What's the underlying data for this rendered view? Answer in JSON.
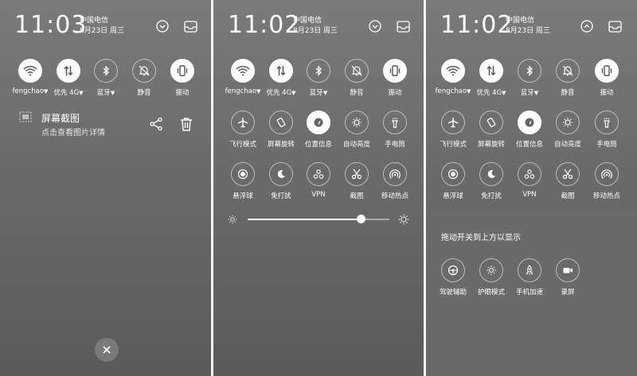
{
  "status": {
    "times": [
      "11:03",
      "11:02",
      "11:02"
    ],
    "carrier": "中国电信",
    "date": "8月23日 周三"
  },
  "toggles": [
    {
      "label": "fengchao",
      "icon": "wifi-icon",
      "dropdown": true,
      "on": true
    },
    {
      "label": "优先 4G",
      "icon": "data-arrows-icon",
      "dropdown": true,
      "on": true
    },
    {
      "label": "蓝牙",
      "icon": "bluetooth-icon",
      "dropdown": true,
      "on": false
    },
    {
      "label": "静音",
      "icon": "mute-bell-icon",
      "dropdown": false,
      "on": false
    },
    {
      "label": "振动",
      "icon": "vibrate-icon",
      "dropdown": false,
      "on": true
    }
  ],
  "toggles_row2": [
    {
      "label": "飞行模式",
      "icon": "airplane-icon",
      "on": false
    },
    {
      "label": "屏幕旋转",
      "icon": "rotate-icon",
      "on": false
    },
    {
      "label": "位置信息",
      "icon": "location-icon",
      "on": true
    },
    {
      "label": "自动亮度",
      "icon": "auto-brightness-icon",
      "on": false
    },
    {
      "label": "手电筒",
      "icon": "flashlight-icon",
      "on": false
    }
  ],
  "toggles_row3": [
    {
      "label": "悬浮球",
      "icon": "float-ball-icon",
      "on": false
    },
    {
      "label": "免打扰",
      "icon": "moon-icon",
      "on": false
    },
    {
      "label": "VPN",
      "icon": "vpn-icon",
      "on": false
    },
    {
      "label": "截图",
      "icon": "scissors-icon",
      "on": false
    },
    {
      "label": "移动热点",
      "icon": "hotspot-icon",
      "on": false
    }
  ],
  "notification": {
    "title": "屏幕截图",
    "subtitle": "点击查看图片详情"
  },
  "brightness": {
    "level": 0.8
  },
  "drag_hint": "拖动开关到上方以显示",
  "extra_toggles": [
    {
      "label": "驾驶辅助",
      "icon": "steering-wheel-icon"
    },
    {
      "label": "护眼模式",
      "icon": "eye-care-icon"
    },
    {
      "label": "手机加速",
      "icon": "rocket-icon"
    },
    {
      "label": "录屏",
      "icon": "screen-record-icon"
    }
  ]
}
